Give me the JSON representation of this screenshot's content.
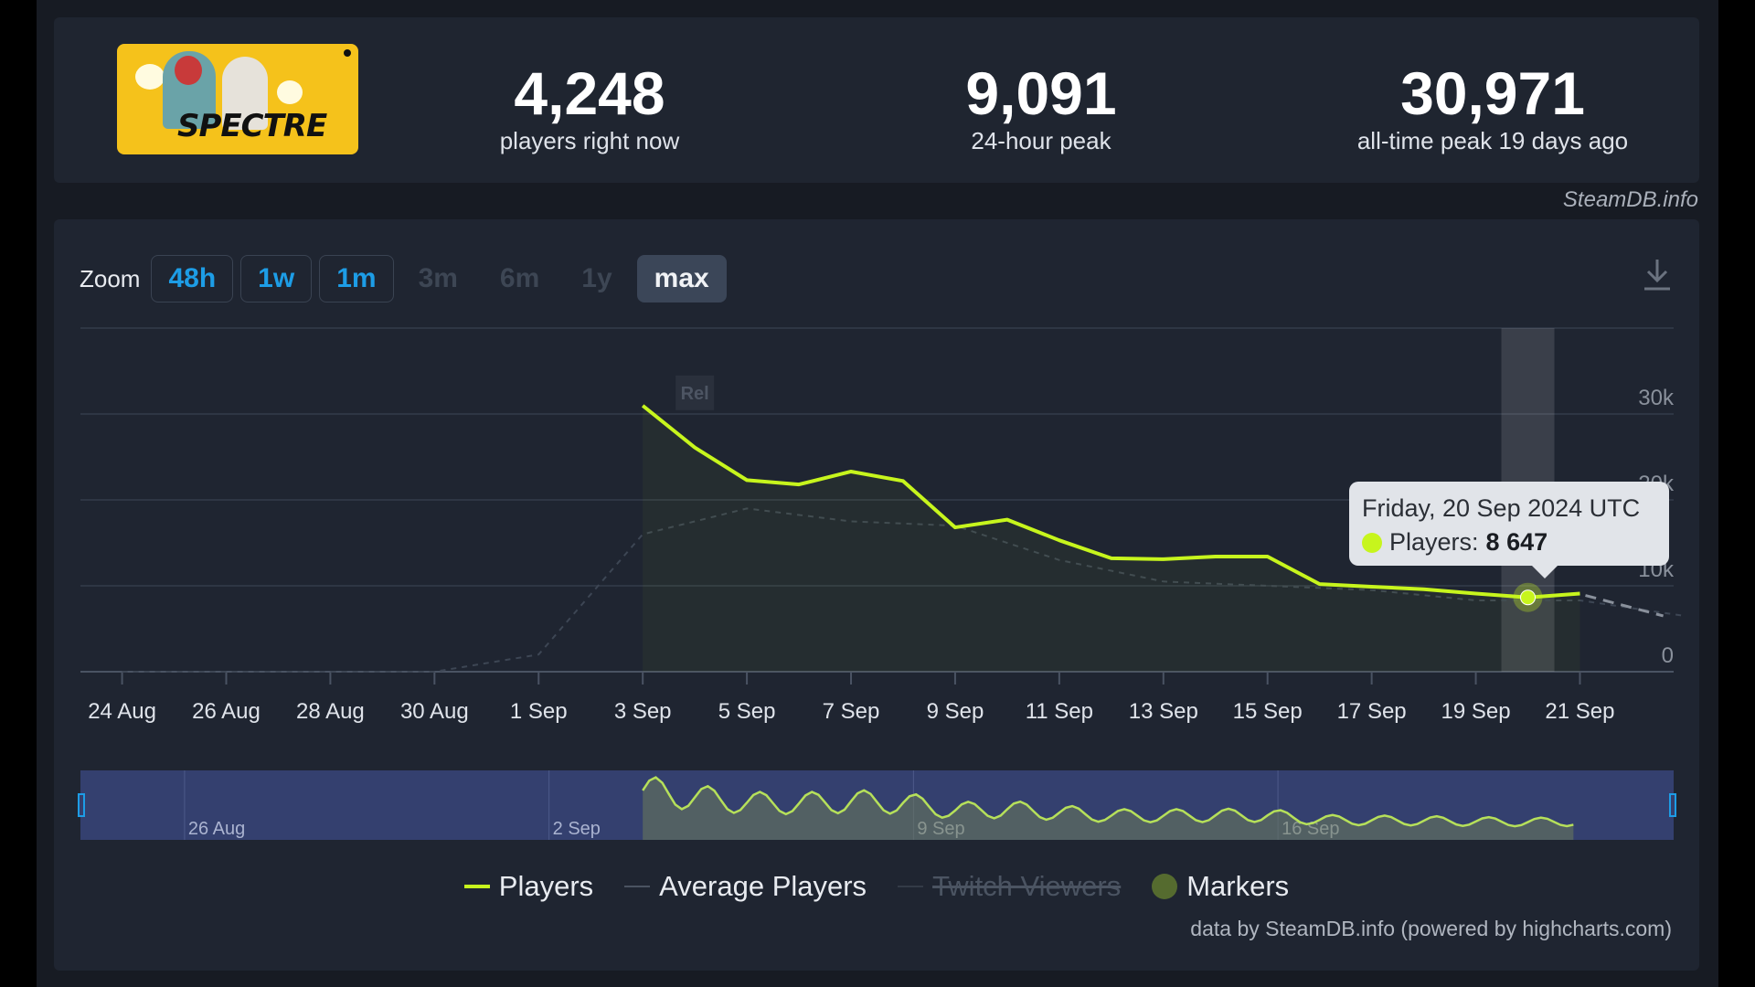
{
  "header": {
    "game_logo_text": "SPECTRE",
    "stats": [
      {
        "value": "4,248",
        "label": "players right now"
      },
      {
        "value": "9,091",
        "label": "24-hour peak"
      },
      {
        "value": "30,971",
        "label": "all-time peak 19 days ago"
      }
    ],
    "credit": "SteamDB.info"
  },
  "zoom": {
    "label": "Zoom",
    "buttons": [
      {
        "label": "48h",
        "state": "enabled"
      },
      {
        "label": "1w",
        "state": "enabled"
      },
      {
        "label": "1m",
        "state": "enabled"
      },
      {
        "label": "3m",
        "state": "disabled"
      },
      {
        "label": "6m",
        "state": "disabled"
      },
      {
        "label": "1y",
        "state": "disabled"
      },
      {
        "label": "max",
        "state": "active"
      }
    ],
    "download_icon": "download-icon"
  },
  "tooltip": {
    "date": "Friday, 20 Sep 2024 UTC",
    "series_label": "Players:",
    "value": "8 647"
  },
  "legend": {
    "players": "Players",
    "average": "Average Players",
    "twitch": "Twitch Viewers",
    "markers": "Markers"
  },
  "footer_credit": "data by SteamDB.info (powered by highcharts.com)",
  "colors": {
    "players": "#c7f51d",
    "average": "#556070",
    "navigator_bg": "#34406f",
    "accent": "#1d9de6"
  },
  "chart_data": {
    "type": "line",
    "title": "",
    "xlabel": "",
    "ylabel": "",
    "ylim": [
      0,
      40000
    ],
    "y_ticks": [
      "0",
      "10k",
      "20k",
      "30k"
    ],
    "x_ticks": [
      "24 Aug",
      "26 Aug",
      "28 Aug",
      "30 Aug",
      "1 Sep",
      "3 Sep",
      "5 Sep",
      "7 Sep",
      "9 Sep",
      "11 Sep",
      "13 Sep",
      "15 Sep",
      "17 Sep",
      "19 Sep",
      "21 Sep"
    ],
    "x_range_days": [
      -0.8,
      29.8
    ],
    "x_origin": "24 Aug 2024",
    "grid": true,
    "legend_position": "bottom-center",
    "marker_flag": {
      "label": "Rel",
      "day": 10
    },
    "highlight_day": 27,
    "series": [
      {
        "name": "Players",
        "x_days": [
          10,
          11,
          12,
          13,
          14,
          15,
          16,
          17,
          18,
          19,
          20,
          21,
          22,
          23,
          24,
          25,
          26,
          27,
          28
        ],
        "values": [
          30971,
          26100,
          22300,
          21800,
          23300,
          22200,
          16800,
          17700,
          15300,
          13200,
          13100,
          13400,
          13400,
          10200,
          9900,
          9600,
          9100,
          8647,
          9091
        ]
      },
      {
        "name": "Average Players",
        "x_days": [
          0,
          6,
          8,
          10,
          12,
          14,
          16,
          18,
          20,
          22,
          24,
          26,
          28,
          29,
          30
        ],
        "values": [
          0,
          0,
          2000,
          16000,
          19000,
          17500,
          17000,
          13000,
          10500,
          10000,
          9500,
          8300,
          8300,
          7400,
          6500
        ]
      }
    ],
    "navigator": {
      "labels": [
        "26 Aug",
        "2 Sep",
        "9 Sep",
        "16 Sep"
      ]
    }
  }
}
